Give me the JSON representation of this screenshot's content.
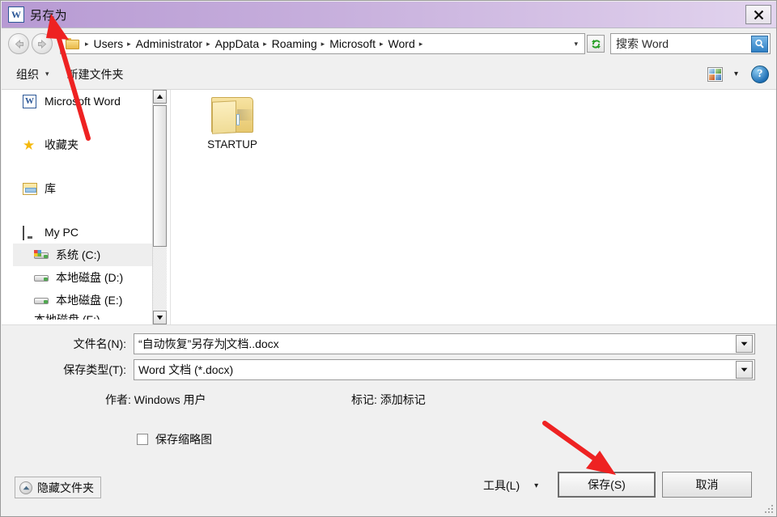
{
  "window": {
    "title": "另存为",
    "app_icon": "word-icon",
    "title_gradient_from": "#b79ad3",
    "title_gradient_to": "#e2d4ee",
    "close_label": "×"
  },
  "addressbar": {
    "back_icon": "back-arrow-icon",
    "forward_icon": "forward-arrow-icon",
    "folder_icon": "folder-icon",
    "crumbs": [
      "Users",
      "Administrator",
      "AppData",
      "Roaming",
      "Microsoft",
      "Word"
    ],
    "separator": "▸",
    "overflow_caret": "▾",
    "refresh_icon": "refresh-icon",
    "search": {
      "placeholder": "搜索 Word",
      "value": "",
      "icon": "search-icon"
    }
  },
  "toolbar": {
    "organize_label": "组织",
    "organize_caret": "▾",
    "new_folder_label": "新建文件夹",
    "view_icon": "view-mode-icon",
    "view_caret": "▾",
    "help_icon": "help-icon",
    "help_label": "?"
  },
  "sidebar": {
    "items": [
      {
        "label": "Microsoft Word",
        "icon": "word-icon",
        "level": "root",
        "selected": false
      },
      {
        "label": "收藏夹",
        "icon": "star-icon",
        "level": "root",
        "selected": false
      },
      {
        "label": "库",
        "icon": "library-icon",
        "level": "root",
        "selected": false
      },
      {
        "label": "My PC",
        "icon": "computer-icon",
        "level": "root",
        "selected": false
      },
      {
        "label": "系统 (C:)",
        "icon": "system-drive-icon",
        "level": "child",
        "selected": true
      },
      {
        "label": "本地磁盘 (D:)",
        "icon": "drive-icon",
        "level": "child",
        "selected": false
      },
      {
        "label": "本地磁盘 (E:)",
        "icon": "drive-icon",
        "level": "child",
        "selected": false
      }
    ],
    "clipped_item": "本地磁盘 (F:)",
    "scrollbar": {
      "up_icon": "scroll-up-icon",
      "down_icon": "scroll-down-icon"
    }
  },
  "filelist": {
    "items": [
      {
        "name": "STARTUP",
        "icon": "folder-icon",
        "type": "folder"
      }
    ]
  },
  "form": {
    "filename_label": "文件名(N):",
    "filename_value_before_caret": "“自动恢复”另存为",
    "filename_value_after_caret": "文档..docx",
    "filename_value": "“自动恢复”另存为文档..docx",
    "filetype_label": "保存类型(T):",
    "filetype_value": "Word 文档 (*.docx)",
    "dropdown_icon": "chevron-down-icon",
    "author_label": "作者:",
    "author_value": "Windows 用户",
    "tags_label": "标记:",
    "tags_value": "添加标记",
    "thumbnail_checkbox_label": "保存缩略图",
    "thumbnail_checked": false
  },
  "footer": {
    "hide_folders_label": "隐藏文件夹",
    "hide_folders_icon": "chevron-up-circle-icon",
    "tools_label": "工具(L)",
    "tools_caret": "▾",
    "save_label": "保存(S)",
    "cancel_label": "取消",
    "resize_grip_icon": "resize-grip-icon"
  },
  "annotations": {
    "arrow_color": "#ee2222",
    "arrows": [
      {
        "name": "arrow-to-title",
        "points_to": "另存为"
      },
      {
        "name": "arrow-to-save-button",
        "points_to": "保存(S)"
      }
    ]
  }
}
